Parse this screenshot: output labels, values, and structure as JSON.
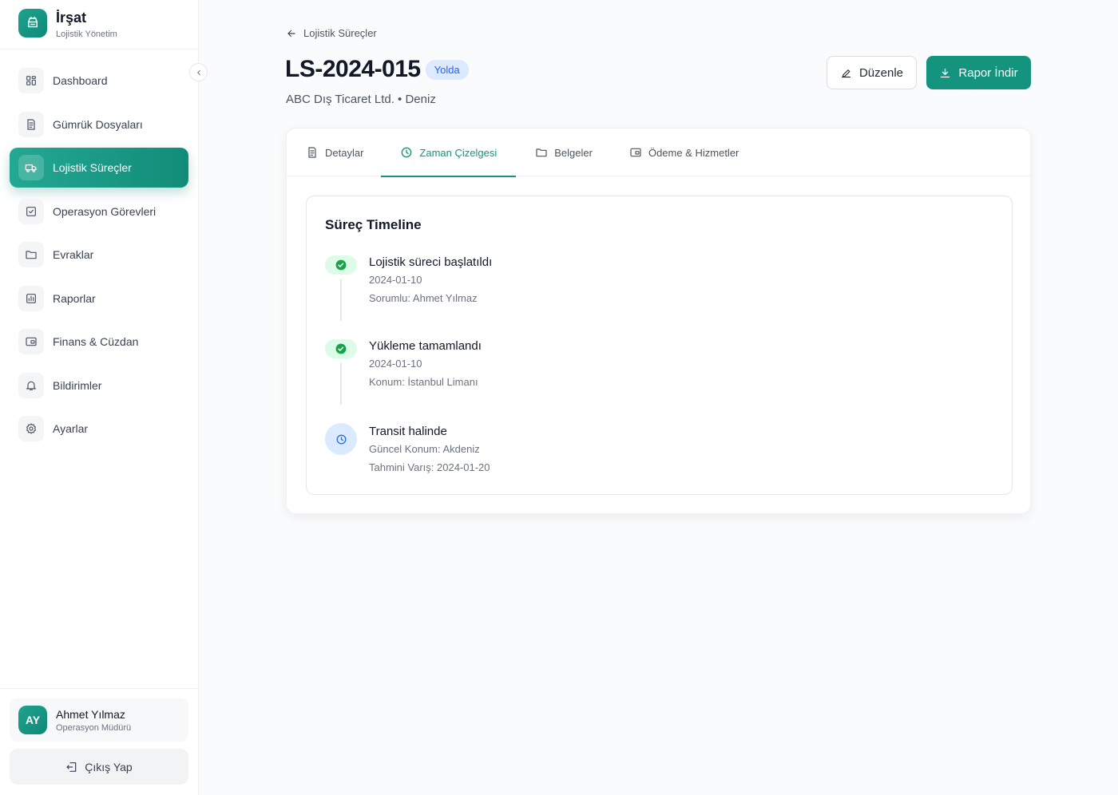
{
  "brand": {
    "title": "İrşat",
    "subtitle": "Lojistik Yönetim"
  },
  "sidebar": {
    "items": [
      {
        "label": "Dashboard",
        "icon": "grid-icon"
      },
      {
        "label": "Gümrük Dosyaları",
        "icon": "document-icon"
      },
      {
        "label": "Lojistik Süreçler",
        "icon": "truck-icon",
        "active": true
      },
      {
        "label": "Operasyon Görevleri",
        "icon": "checkbox-icon"
      },
      {
        "label": "Evraklar",
        "icon": "folder-icon"
      },
      {
        "label": "Raporlar",
        "icon": "chart-icon"
      },
      {
        "label": "Finans & Cüzdan",
        "icon": "wallet-icon"
      },
      {
        "label": "Bildirimler",
        "icon": "bell-icon"
      },
      {
        "label": "Ayarlar",
        "icon": "gear-icon"
      }
    ]
  },
  "user": {
    "initials": "AY",
    "name": "Ahmet Yılmaz",
    "role": "Operasyon Müdürü"
  },
  "logout_label": "Çıkış Yap",
  "header": {
    "back_label": "Lojistik Süreçler",
    "title": "LS-2024-015",
    "status": "Yolda",
    "subtitle": "ABC Dış Ticaret Ltd. • Deniz",
    "edit_label": "Düzenle",
    "report_label": "Rapor İndir"
  },
  "tabs": [
    {
      "label": "Detaylar",
      "icon": "document-icon"
    },
    {
      "label": "Zaman Çizelgesi",
      "icon": "clock-icon",
      "active": true
    },
    {
      "label": "Belgeler",
      "icon": "folder-icon"
    },
    {
      "label": "Ödeme & Hizmetler",
      "icon": "wallet-icon"
    }
  ],
  "timeline": {
    "title": "Süreç Timeline",
    "items": [
      {
        "title": "Lojistik süreci başlatıldı",
        "line1": "2024-01-10",
        "line2": "Sorumlu: Ahmet Yılmaz",
        "status": "completed"
      },
      {
        "title": "Yükleme tamamlandı",
        "line1": "2024-01-10",
        "line2": "Konum: İstanbul Limanı",
        "status": "completed"
      },
      {
        "title": "Transit halinde",
        "line1": "Güncel Konum: Akdeniz",
        "line2": "Tahmini Varış: 2024-01-20",
        "status": "in-progress"
      }
    ]
  },
  "colors": {
    "accent": "#14937f",
    "badge_bg": "#dbeafe",
    "badge_text": "#2563eb",
    "success": "#16a34a"
  }
}
